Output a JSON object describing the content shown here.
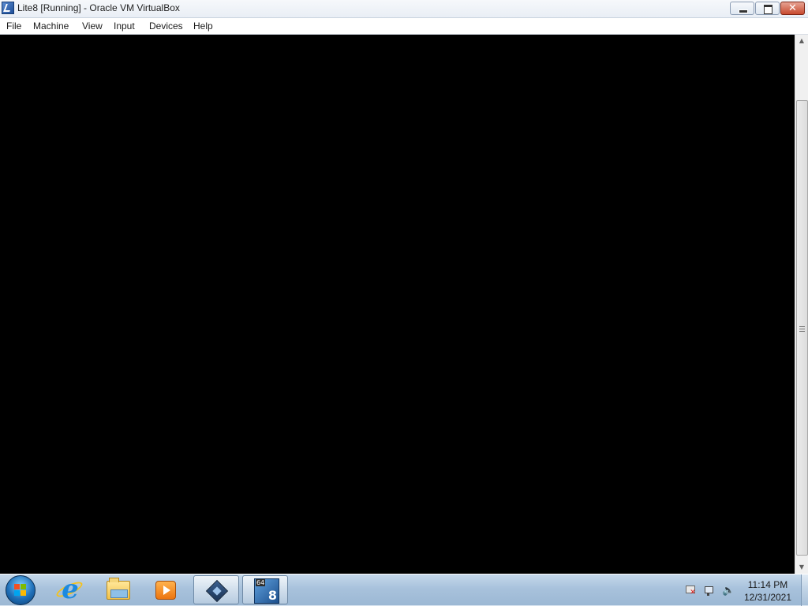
{
  "window": {
    "title": "Lite8 [Running] - Oracle VM VirtualBox",
    "icon": "virtualbox-vm-icon",
    "controls": {
      "minimize_icon": "minimize-icon",
      "maximize_icon": "maximize-icon",
      "close_icon": "close-icon",
      "close_glyph": "✕"
    }
  },
  "menu": {
    "items": [
      {
        "label": "File"
      },
      {
        "label": "Machine"
      },
      {
        "label": "View"
      },
      {
        "label": "Input"
      },
      {
        "label": "Devices"
      },
      {
        "label": "Help"
      }
    ]
  },
  "vm_screen": {
    "background": "#000000"
  },
  "scrollbar": {
    "up_glyph": "▲",
    "down_glyph": "▼"
  },
  "taskbar": {
    "pinned": [
      {
        "name": "internet-explorer-icon",
        "glyph": "e"
      },
      {
        "name": "windows-explorer-icon"
      },
      {
        "name": "media-player-icon"
      },
      {
        "name": "virtualbox-icon"
      },
      {
        "name": "lite8-vm-icon",
        "badge": "64",
        "number": "8"
      }
    ],
    "tray": {
      "volume_glyph": "🔈"
    },
    "clock": {
      "time": "11:14 PM",
      "date": "12/31/2021"
    }
  },
  "colors": {
    "taskbar": "#a8c2dc",
    "close_button": "#c84a2f",
    "vm_background": "#000000"
  }
}
